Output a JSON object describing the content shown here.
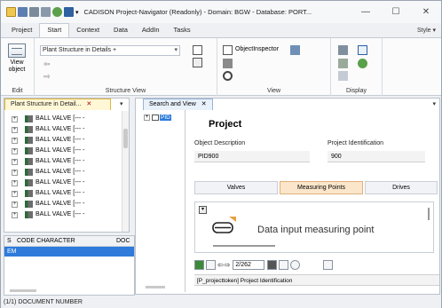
{
  "window": {
    "title": "CADISON Project-Navigator (Readonly) - Domain: BGW - Database: PORT...",
    "controls": {
      "minimize": "—",
      "maximize": "☐",
      "close": "✕"
    }
  },
  "ribbon": {
    "tabs": [
      "Project",
      "Start",
      "Context",
      "Data",
      "AddIn",
      "Tasks"
    ],
    "active_tab": "Start",
    "style_label": "Style ▾",
    "groups": {
      "edit": {
        "label": "Edit",
        "view_object": "View object"
      },
      "structure_view": {
        "label": "Structure View",
        "combo_value": "Plant Structure in Details +"
      },
      "view": {
        "label": "View",
        "object_inspector": "ObjectInspector"
      },
      "display": {
        "label": "Display"
      }
    }
  },
  "left_pane": {
    "tab_label": "Plant Structure in Detail...",
    "tree_items": [
      "BALL VALVE    [---  -",
      "BALL VALVE    [---  -",
      "BALL VALVE    [---  -",
      "BALL VALVE    [---  -",
      "BALL VALVE    [---  -",
      "BALL VALVE    [---  -",
      "BALL VALVE    [---  -",
      "BALL VALVE    [---  -",
      "BALL VALVE    [---  -",
      "BALL VALVE    [---  -"
    ]
  },
  "left_grid": {
    "columns": [
      "S",
      "CODE CHARACTER",
      "DOC"
    ],
    "rows": [
      [
        "EM",
        "",
        ""
      ]
    ]
  },
  "status_bar": {
    "text": "(1/1)  DOCUMENT NUMBER"
  },
  "right_pane": {
    "tab_label": "Search and View",
    "tree_node": "PID",
    "detail": {
      "title": "Project",
      "object_description_label": "Object Description",
      "object_description_value": "PID900",
      "project_identification_label": "Project Identification",
      "project_identification_value": "900",
      "subtabs": [
        "Valves",
        "Measuring Points",
        "Drives"
      ],
      "active_subtab": "Measuring Points",
      "preview_text": "Data input measuring point",
      "navigator_count": "2/262",
      "footer_text": "[P_projecttoken] Project Identification"
    }
  },
  "colors": {
    "selection": "#2e7bdc",
    "active_subtab": "#fbe6cb",
    "left_tab": "#fff7d6"
  }
}
